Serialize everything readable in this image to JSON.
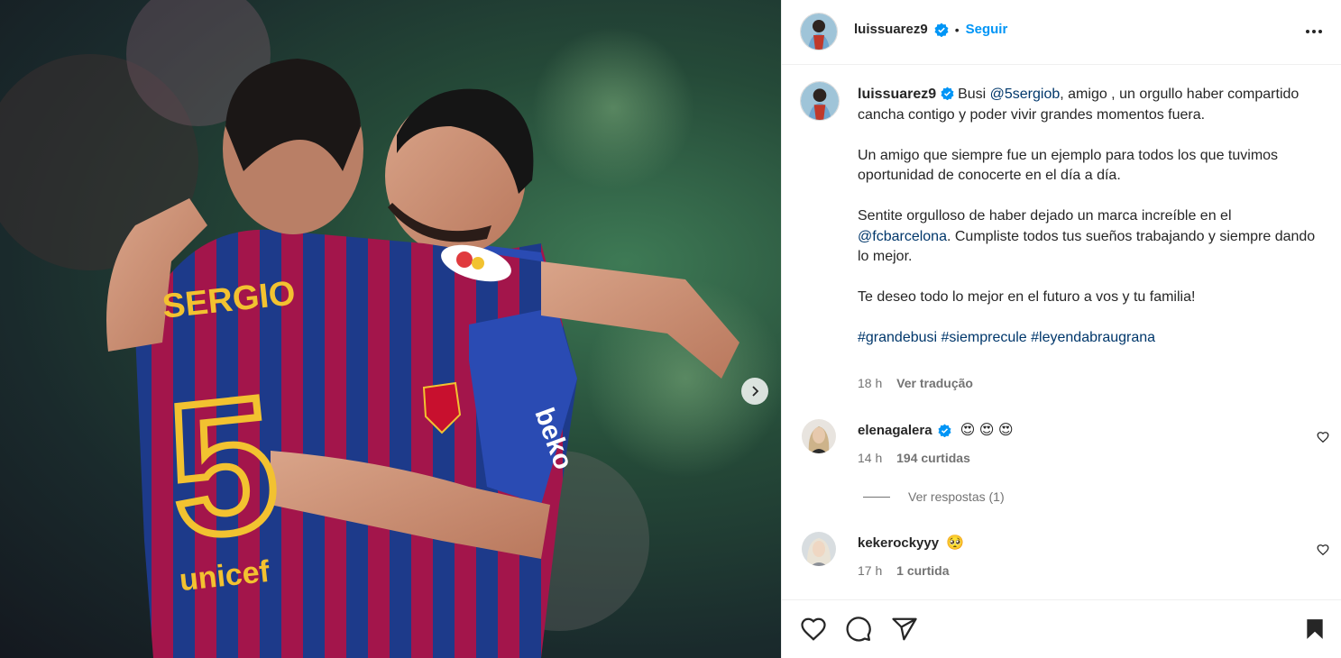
{
  "post": {
    "author": "luissuarez9",
    "follow_label": "Seguir",
    "dot": "•",
    "jersey_name": "SERGIO",
    "jersey_number": "5",
    "sponsor": "unicef",
    "kit_brand": "beko"
  },
  "caption": {
    "username": "luissuarez9",
    "line1_prefix": "Busi ",
    "mention1": "@5sergiob",
    "line1_rest": ", amigo , un orgullo haber compartido cancha contigo y poder vivir grandes momentos fuera.",
    "para2": "Un amigo que siempre fue un ejemplo para todos los que tuvimos oportunidad de conocerte en el día a día.",
    "para3_prefix": "Sentite orgulloso de haber dejado un marca increíble en el ",
    "mention2": "@fcbarcelona",
    "para3_rest": ". Cumpliste todos tus sueños trabajando y siempre dando lo mejor.",
    "para4": "Te deseo todo lo mejor en el futuro a vos y tu familia!",
    "hashtags": [
      "#grandebusi",
      "#siemprecule",
      "#leyendabraugrana"
    ],
    "time": "18 h",
    "translate": "Ver tradução"
  },
  "comments": [
    {
      "username": "elenagalera",
      "emoji": "😍 😍 😍",
      "time": "14 h",
      "likes": "194 curtidas",
      "replies": "Ver respostas (1)"
    },
    {
      "username": "kekerockyyy",
      "emoji": "🥺",
      "time": "17 h",
      "likes": "1 curtida"
    }
  ],
  "icons": {
    "like": "heart-icon",
    "comment": "comment-icon",
    "share": "share-icon",
    "save": "bookmark-icon",
    "more": "more-icon",
    "next": "chevron-right-icon",
    "verified": "verified-badge-icon"
  },
  "colors": {
    "accent": "#0095f6",
    "link": "#00376b",
    "verified": "#0095f6",
    "muted": "#737373"
  }
}
